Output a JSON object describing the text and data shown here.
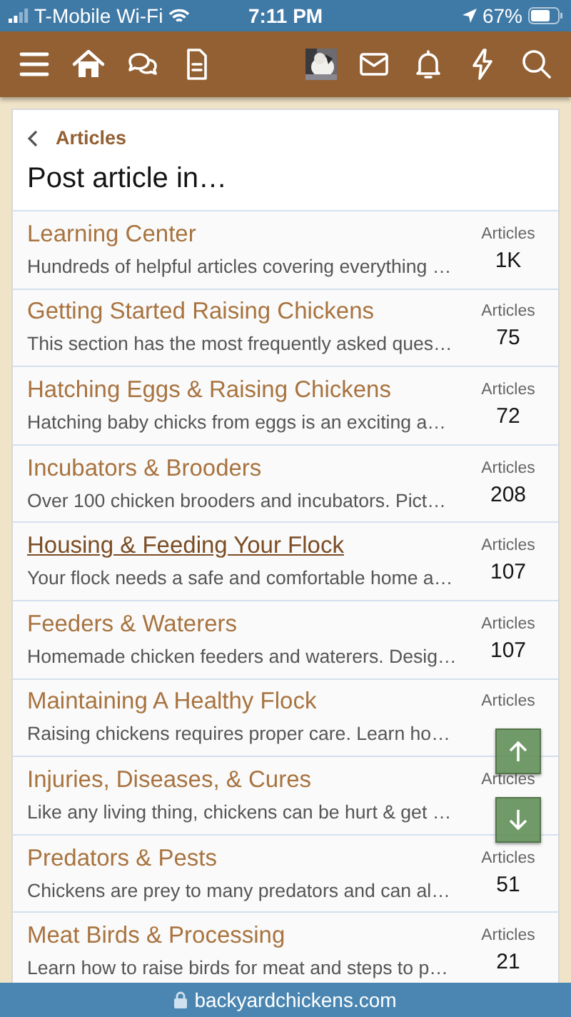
{
  "status_bar": {
    "carrier": "T-Mobile Wi-Fi",
    "time": "7:11 PM",
    "battery": "67%"
  },
  "breadcrumb": {
    "label": "Articles"
  },
  "title": "Post article in…",
  "categories": [
    {
      "title": "Learning Center",
      "description": "Hundreds of helpful articles covering everything …",
      "stat_label": "Articles",
      "count": "1K",
      "underlined": false
    },
    {
      "title": "Getting Started Raising Chickens",
      "description": "This section has the most frequently asked ques…",
      "stat_label": "Articles",
      "count": "75",
      "underlined": false
    },
    {
      "title": "Hatching Eggs & Raising Chickens",
      "description": "Hatching baby chicks from eggs is an exciting a…",
      "stat_label": "Articles",
      "count": "72",
      "underlined": false
    },
    {
      "title": "Incubators & Brooders",
      "description": "Over 100 chicken brooders and incubators. Pict…",
      "stat_label": "Articles",
      "count": "208",
      "underlined": false
    },
    {
      "title": "Housing & Feeding Your Flock",
      "description": "Your flock needs a safe and comfortable home a…",
      "stat_label": "Articles",
      "count": "107",
      "underlined": true
    },
    {
      "title": "Feeders & Waterers",
      "description": "Homemade chicken feeders and waterers. Desig…",
      "stat_label": "Articles",
      "count": "107",
      "underlined": false
    },
    {
      "title": "Maintaining A Healthy Flock",
      "description": "Raising chickens requires proper care. Learn ho…",
      "stat_label": "Articles",
      "underlined": false
    },
    {
      "title": "Injuries, Diseases, & Cures",
      "description": "Like any living thing, chickens can be hurt & get …",
      "stat_label": "Articles",
      "underlined": false
    },
    {
      "title": "Predators & Pests",
      "description": "Chickens are prey to many predators and can al…",
      "stat_label": "Articles",
      "count": "51",
      "underlined": false
    },
    {
      "title": "Meat Birds & Processing",
      "description": "Learn how to raise birds for meat and steps to p…",
      "stat_label": "Articles",
      "count": "21",
      "underlined": false
    }
  ],
  "url_bar": {
    "domain": "backyardchickens.com"
  }
}
